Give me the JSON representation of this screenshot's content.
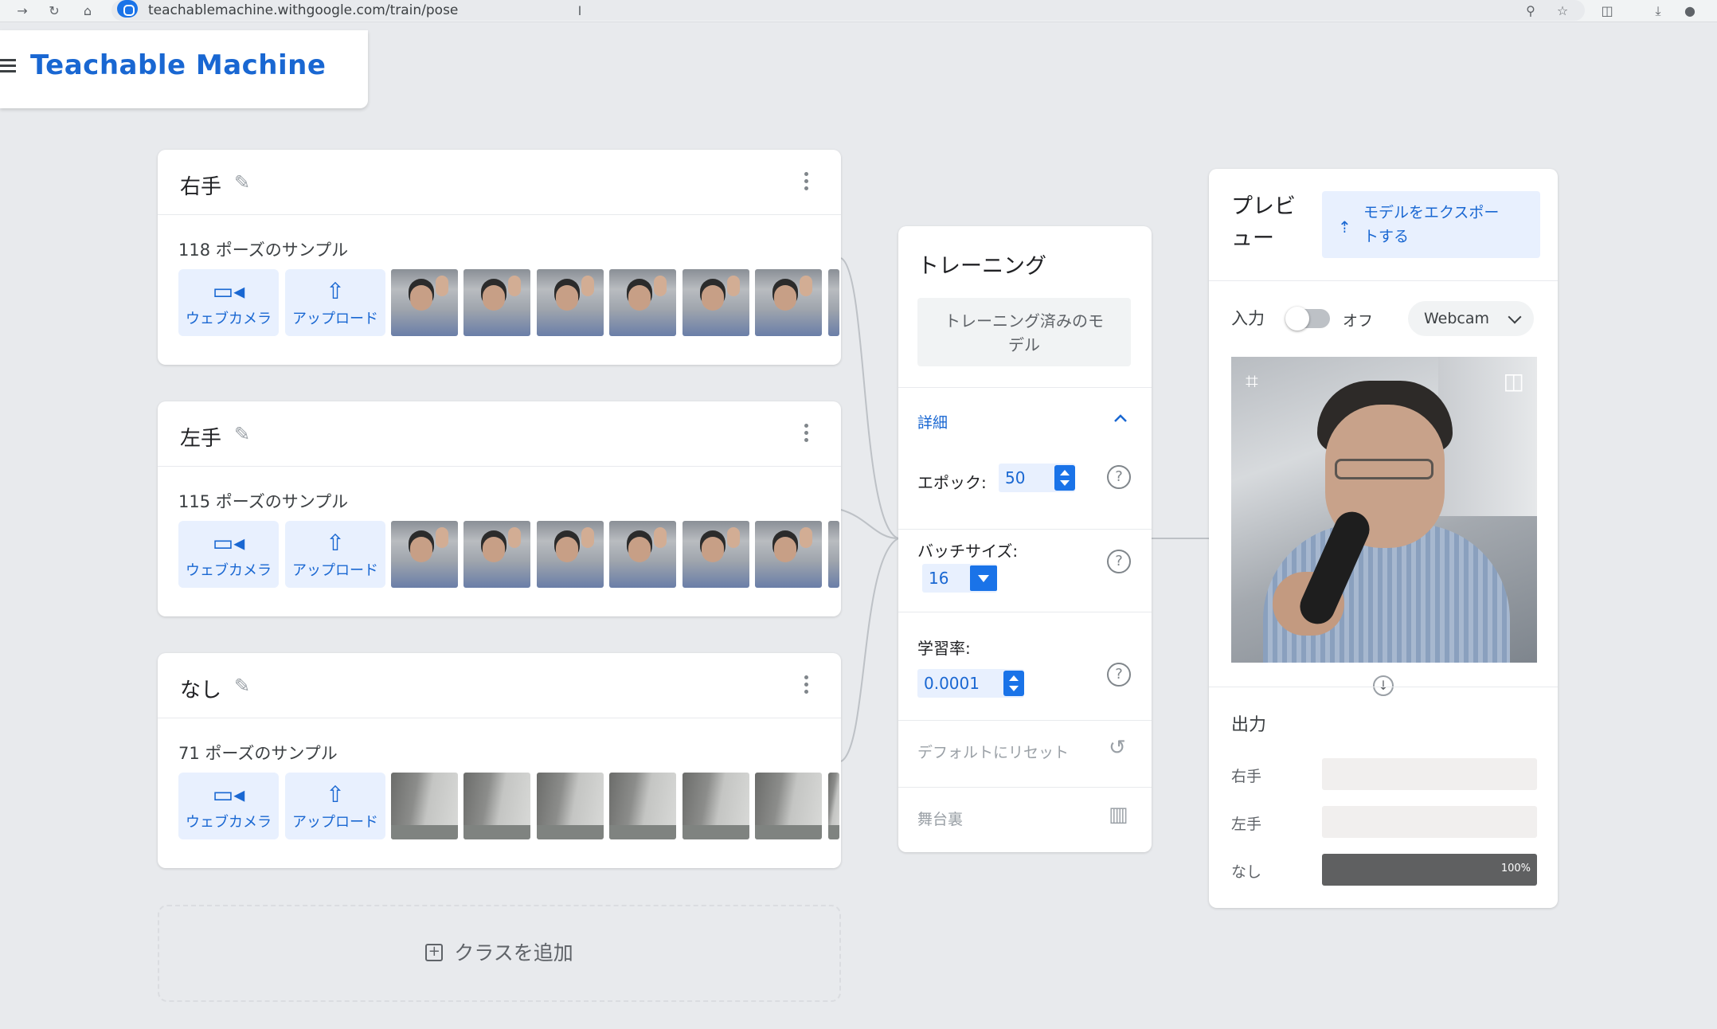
{
  "browser": {
    "url": "teachablemachine.withgoogle.com/train/pose"
  },
  "app": {
    "title": "Teachable Machine"
  },
  "classes": [
    {
      "name": "右手",
      "samples_label": "118 ポーズのサンプル",
      "webcam_label": "ウェブカメラ",
      "upload_label": "アップロード"
    },
    {
      "name": "左手",
      "samples_label": "115 ポーズのサンプル",
      "webcam_label": "ウェブカメラ",
      "upload_label": "アップロード"
    },
    {
      "name": "なし",
      "samples_label": "71 ポーズのサンプル",
      "webcam_label": "ウェブカメラ",
      "upload_label": "アップロード"
    }
  ],
  "add_class_label": "クラスを追加",
  "training": {
    "title": "トレーニング",
    "train_button_line1": "トレーニング済みのモ",
    "train_button_line2": "デル",
    "advanced_label": "詳細",
    "epochs_label": "エポック:",
    "epochs_value": "50",
    "batch_label": "バッチサイズ:",
    "batch_value": "16",
    "lr_label": "学習率:",
    "lr_value": "0.0001",
    "reset_label": "デフォルトにリセット",
    "backstage_label": "舞台裏"
  },
  "preview": {
    "title_line1": "プレビ",
    "title_line2": "ュー",
    "export_line1": "モデルをエクスポー",
    "export_line2": "トする",
    "input_label": "入力",
    "toggle_state": "オフ",
    "source_select": "Webcam",
    "output_title": "出力",
    "outputs": [
      {
        "label": "右手",
        "value": 0
      },
      {
        "label": "左手",
        "value": 0
      },
      {
        "label": "なし",
        "value": 100,
        "display": "100%"
      }
    ]
  },
  "colors": {
    "brand_blue": "#1967d2",
    "button_bg": "#e8f0fe",
    "page_bg": "#e8eaed"
  }
}
